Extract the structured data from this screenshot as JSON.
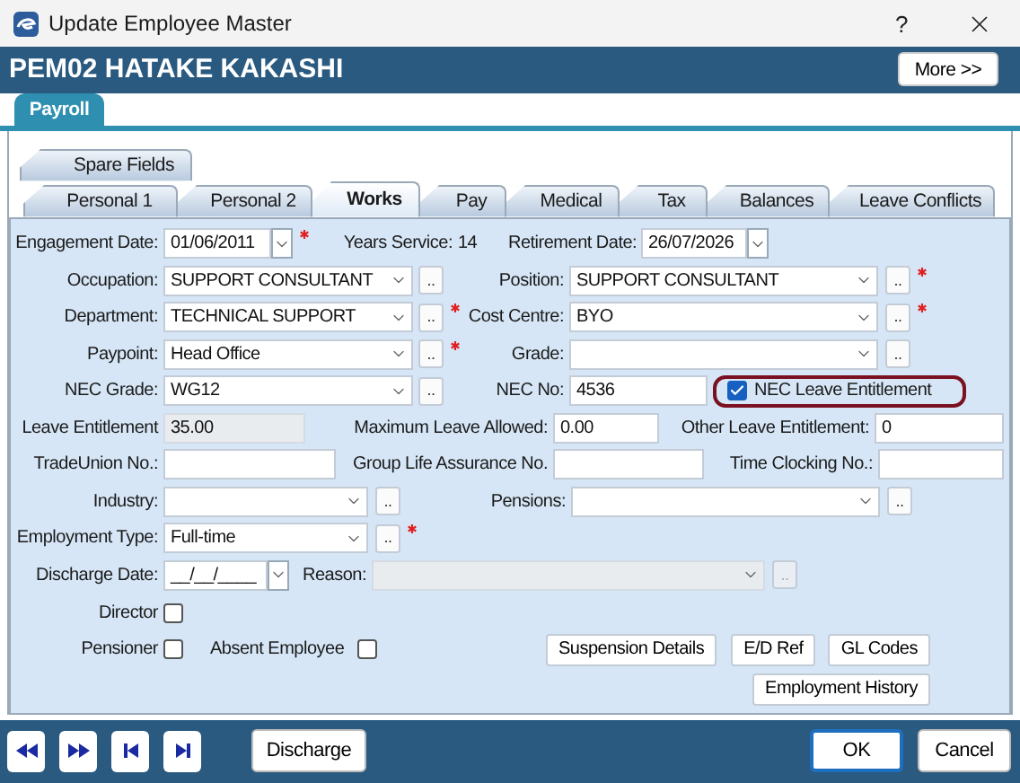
{
  "window": {
    "title": "Update Employee Master",
    "help": "?"
  },
  "header": {
    "employee": "PEM02 HATAKE KAKASHI",
    "more_button": "More >>"
  },
  "module_tabs": [
    {
      "label": "Payroll",
      "selected": true
    }
  ],
  "tabs_back": [
    {
      "label": "Spare Fields",
      "selected": false
    }
  ],
  "tabs": [
    {
      "label": "Personal 1",
      "selected": false
    },
    {
      "label": "Personal 2",
      "selected": false
    },
    {
      "label": "Works",
      "selected": true
    },
    {
      "label": "Pay",
      "selected": false
    },
    {
      "label": "Medical",
      "selected": false
    },
    {
      "label": "Tax",
      "selected": false
    },
    {
      "label": "Balances",
      "selected": false
    },
    {
      "label": "Leave Conflicts",
      "selected": false
    }
  ],
  "form": {
    "engagement_date": {
      "label": "Engagement Date:",
      "value": "01/06/2011",
      "required": true
    },
    "years_service": {
      "label": "Years Service:",
      "value": "14"
    },
    "retirement_date": {
      "label": "Retirement Date:",
      "value": "26/07/2026"
    },
    "occupation": {
      "label": "Occupation:",
      "value": "SUPPORT CONSULTANT",
      "lookup": ".."
    },
    "position": {
      "label": "Position:",
      "value": "SUPPORT CONSULTANT",
      "lookup": "..",
      "required": true
    },
    "department": {
      "label": "Department:",
      "value": "TECHNICAL SUPPORT",
      "lookup": "..",
      "required": true
    },
    "cost_centre": {
      "label": "Cost Centre:",
      "value": "BYO",
      "lookup": "..",
      "required": true
    },
    "paypoint": {
      "label": "Paypoint:",
      "value": "Head Office",
      "lookup": "..",
      "required": true
    },
    "grade": {
      "label": "Grade:",
      "lookup": ".."
    },
    "nec_grade": {
      "label": "NEC Grade:",
      "value": "WG12",
      "lookup": ".."
    },
    "nec_no": {
      "label": "NEC No:",
      "value": "4536"
    },
    "nec_leave_entitlement": {
      "label": "NEC Leave Entitlement",
      "checked": true,
      "highlighted": true
    },
    "leave_entitlement": {
      "label": "Leave Entitlement",
      "value": "35.00",
      "disabled": true
    },
    "maximum_leave_allowed": {
      "label": "Maximum Leave Allowed:",
      "value": "0.00"
    },
    "other_leave_entitlement": {
      "label": "Other Leave Entitlement:",
      "value": "0"
    },
    "trade_union_no": {
      "label": "TradeUnion No.:"
    },
    "group_life_assurance_no": {
      "label": "Group Life Assurance No."
    },
    "time_clocking_no": {
      "label": "Time Clocking No.:"
    },
    "industry": {
      "label": "Industry:",
      "lookup": ".."
    },
    "pensions": {
      "label": "Pensions:",
      "lookup": ".."
    },
    "employment_type": {
      "label": "Employment Type:",
      "value": "Full-time",
      "lookup": "..",
      "required": true
    },
    "discharge_date": {
      "label": "Discharge Date:",
      "value": "__/__/____"
    },
    "reason": {
      "label": "Reason:",
      "lookup": "..",
      "disabled": true
    },
    "director": {
      "label": "Director",
      "checked": false
    },
    "pensioner": {
      "label": "Pensioner",
      "checked": false
    },
    "absent_employee": {
      "label": "Absent Employee",
      "checked": false
    }
  },
  "action_buttons": [
    "Suspension Details",
    "E/D Ref",
    "GL Codes",
    "Employment History"
  ],
  "footer": {
    "discharge": "Discharge",
    "ok": "OK",
    "cancel": "Cancel"
  }
}
